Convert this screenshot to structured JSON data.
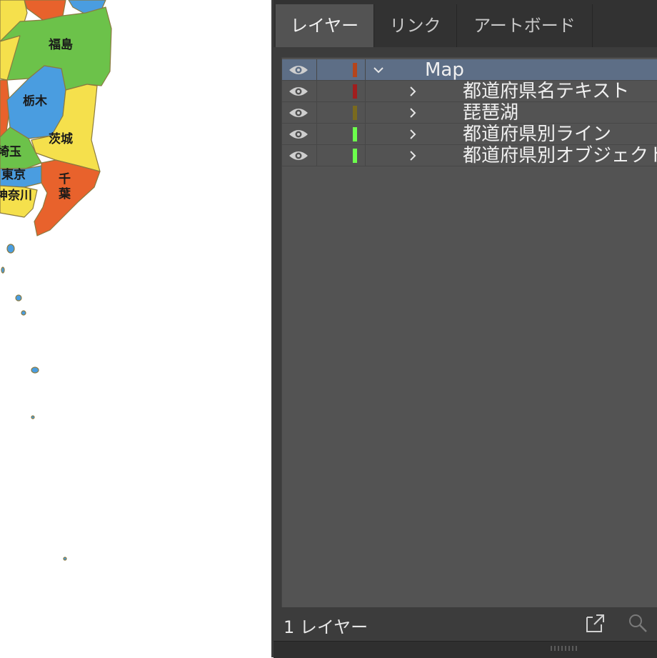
{
  "map": {
    "colors": {
      "green": "#6cc24a",
      "yellow": "#f5e04c",
      "blue": "#4a9de0",
      "orange": "#e8622c",
      "outline": "#8a7a40"
    },
    "labels": {
      "fukushima": "福島",
      "tochigi": "栃木",
      "ibaraki": "茨城",
      "saitama": "埼玉",
      "tokyo": "東京",
      "kanagawa": "神奈川",
      "chiba_1": "千",
      "chiba_2": "葉"
    }
  },
  "panel": {
    "tabs": [
      {
        "label": "レイヤー",
        "active": true
      },
      {
        "label": "リンク",
        "active": false
      },
      {
        "label": "アートボード",
        "active": false
      }
    ],
    "layers": [
      {
        "name": "Map",
        "color": "#b5451b",
        "expanded": true,
        "selected": true,
        "visible": true
      },
      {
        "name": "都道府県名テキスト",
        "color": "#a01e1e",
        "expanded": false,
        "selected": false,
        "visible": true
      },
      {
        "name": "琵琶湖",
        "color": "#7a6a1e",
        "expanded": false,
        "selected": false,
        "visible": true
      },
      {
        "name": "都道府県別ライン",
        "color": "#6cff4c",
        "expanded": false,
        "selected": false,
        "visible": true
      },
      {
        "name": "都道府県別オブジェクト",
        "color": "#6cff4c",
        "expanded": false,
        "selected": false,
        "visible": true
      }
    ],
    "footer": {
      "count_label": "1 レイヤー",
      "icons": [
        "export-icon",
        "search-icon"
      ]
    }
  }
}
